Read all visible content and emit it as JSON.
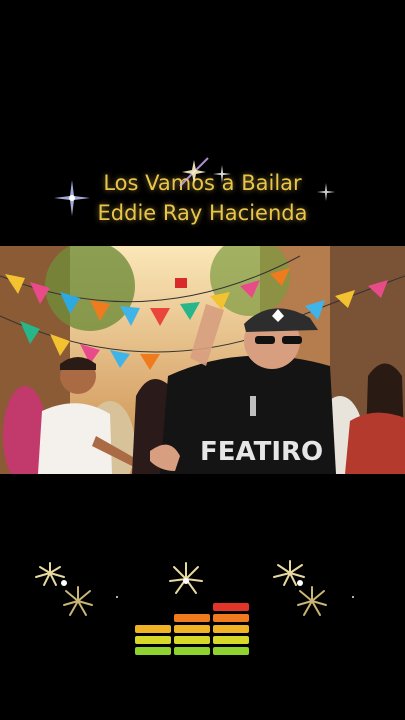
{
  "video": {
    "title_line1": "Los Vamos a Bailar",
    "title_line2": "Eddie Ray Hacienda",
    "title_color": "#e9c64a"
  },
  "scene": {
    "icon": "street-party-photo",
    "shirt_print": "FEATIRO"
  },
  "visualizer": {
    "icon": "audio-equalizer",
    "levels": [
      0.6,
      0.7,
      0.95
    ],
    "colors": {
      "top": "#e3342a",
      "upper": "#f07a1e",
      "middle": "#f0b323",
      "lower": "#d6d82a",
      "bottom": "#8fd42e"
    }
  }
}
